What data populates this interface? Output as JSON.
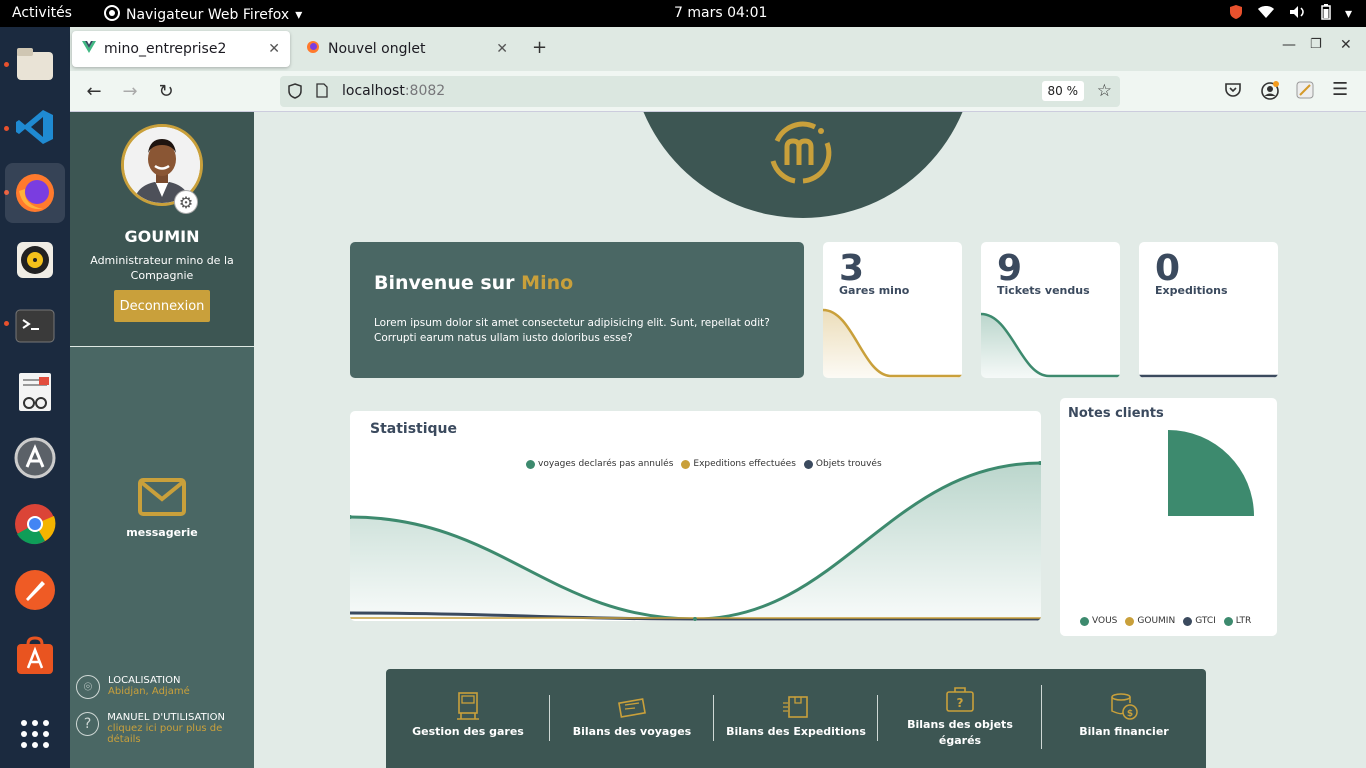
{
  "system": {
    "activities": "Activités",
    "app_menu": "Navigateur Web Firefox",
    "clock": "7 mars  04:01"
  },
  "browser": {
    "tabs": [
      {
        "label": "mino_entreprise2"
      },
      {
        "label": "Nouvel onglet"
      }
    ],
    "url_host": "localhost",
    "url_port": ":8082",
    "zoom": "80 %"
  },
  "sidebar": {
    "user_name": "GOUMIN",
    "user_role": "Administrateur mino de la Compagnie",
    "logout_label": "Deconnexion",
    "messaging_label": "messagerie",
    "location_title": "LOCALISATION",
    "location_value": "Abidjan, Adjamé",
    "manual_title": "MANUEL D'UTILISATION",
    "manual_link": "cliquez ici pour plus de détails"
  },
  "welcome": {
    "prefix": "Binvenue sur ",
    "brand": "Mino",
    "text": "Lorem ipsum dolor sit amet consectetur adipisicing elit. Sunt, repellat odit? Corrupti earum natus ullam iusto doloribus esse?"
  },
  "stats": [
    {
      "value": "3",
      "label": "Gares mino"
    },
    {
      "value": "9",
      "label": "Tickets vendus"
    },
    {
      "value": "0",
      "label": "Expeditions"
    }
  ],
  "statistique": {
    "title": "Statistique",
    "legend": [
      "voyages declarés pas annulés",
      "Expeditions effectuées",
      "Objets trouvés"
    ]
  },
  "notes": {
    "title": "Notes clients",
    "legend": [
      "VOUS",
      "GOUMIN",
      "GTCI",
      "LTR"
    ]
  },
  "bottom_menu": [
    "Gestion des gares",
    "Bilans des voyages",
    "Bilans des Expeditions",
    "Bilans des objets égarés",
    "Bilan financier"
  ],
  "colors": {
    "dark": "#3d5653",
    "mid": "#4a6764",
    "gold": "#c9a03b",
    "green": "#3d8a6e",
    "slate": "#3b4a5e"
  }
}
